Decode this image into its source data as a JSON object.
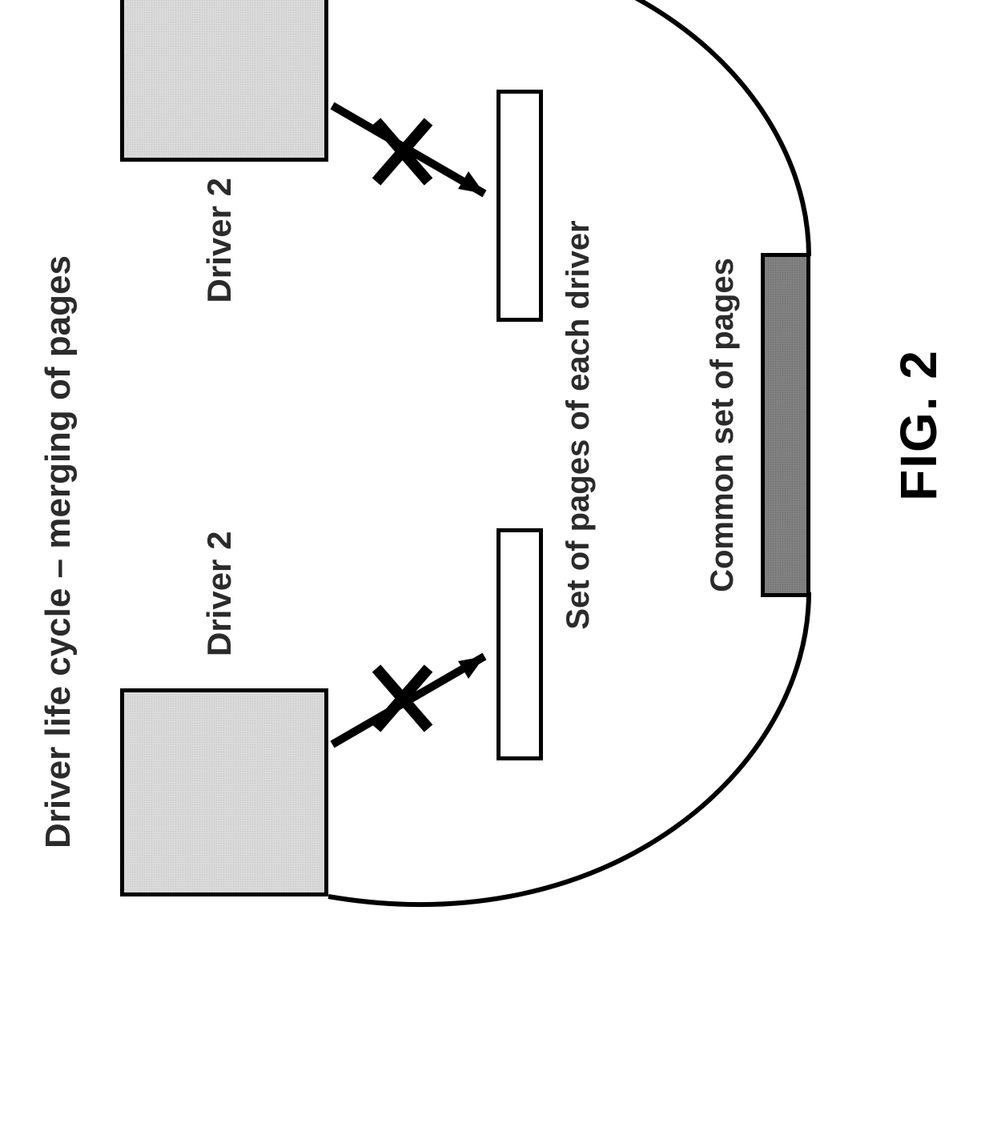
{
  "title": "Driver life cycle – merging of pages",
  "driver_left_label": "Driver 2",
  "driver_right_label": "Driver 2",
  "set_of_pages_label": "Set of pages of each driver",
  "common_set_label": "Common set of pages",
  "figure_label": "FIG. 2",
  "colors": {
    "driver_fill": "#d9d9d9",
    "common_fill": "#808080",
    "stroke": "#000000"
  },
  "diagram": {
    "type": "schematic",
    "entities": [
      {
        "id": "driver-left",
        "kind": "driver",
        "label_ref": "driver_left_label"
      },
      {
        "id": "driver-right",
        "kind": "driver",
        "label_ref": "driver_right_label"
      },
      {
        "id": "pages-left",
        "kind": "page-set"
      },
      {
        "id": "pages-right",
        "kind": "page-set"
      },
      {
        "id": "common-pages",
        "kind": "common-page-set",
        "label_ref": "common_set_label"
      }
    ],
    "edges": [
      {
        "from": "driver-left",
        "to": "pages-left",
        "crossed_out": true,
        "style": "arrow"
      },
      {
        "from": "driver-right",
        "to": "pages-right",
        "crossed_out": true,
        "style": "arrow"
      },
      {
        "from": "driver-left",
        "to": "common-pages",
        "style": "curve"
      },
      {
        "from": "driver-right",
        "to": "common-pages",
        "style": "curve"
      }
    ]
  }
}
